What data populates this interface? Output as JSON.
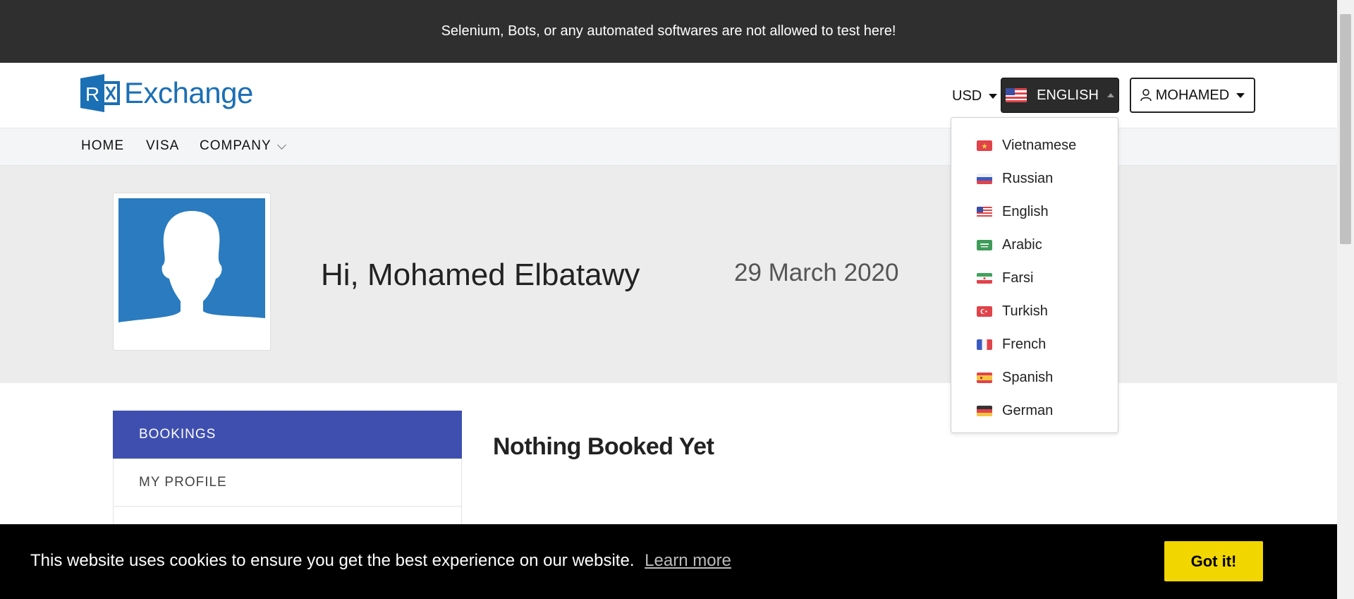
{
  "topbar": {
    "message": "Selenium, Bots, or any automated softwares are not allowed to test here!"
  },
  "brand": {
    "name": "Exchange",
    "mark_letter": "R",
    "color": "#1b6fb5"
  },
  "header": {
    "currency": "USD",
    "language_button": {
      "label": "ENGLISH",
      "flag": "us-flag"
    },
    "user_button": {
      "label": "MOHAMED",
      "icon": "user-icon"
    }
  },
  "nav": {
    "items": [
      "HOME",
      "VISA",
      "COMPANY"
    ]
  },
  "profile": {
    "greeting": "Hi, Mohamed Elbatawy",
    "date": "29 March 2020",
    "avatar": "avatar-placeholder"
  },
  "sidebar": {
    "items": [
      "BOOKINGS",
      "MY PROFILE"
    ]
  },
  "main": {
    "empty_title": "Nothing Booked Yet"
  },
  "language_menu": {
    "items": [
      {
        "label": "Vietnamese",
        "flag": "vietnam-flag"
      },
      {
        "label": "Russian",
        "flag": "russia-flag"
      },
      {
        "label": "English",
        "flag": "us-flag"
      },
      {
        "label": "Arabic",
        "flag": "saudi-flag"
      },
      {
        "label": "Farsi",
        "flag": "iran-flag"
      },
      {
        "label": "Turkish",
        "flag": "turkey-flag"
      },
      {
        "label": "French",
        "flag": "france-flag"
      },
      {
        "label": "Spanish",
        "flag": "spain-flag"
      },
      {
        "label": "German",
        "flag": "germany-flag"
      }
    ]
  },
  "cookie": {
    "message": "This website uses cookies to ensure you get the best experience on our website.",
    "link": "Learn more",
    "button": "Got it!"
  },
  "colors": {
    "topbar": "#2f2f2f",
    "sidebar_active": "#3f4fb0",
    "cookie_button": "#f1d600",
    "brand": "#1b6fb5"
  }
}
